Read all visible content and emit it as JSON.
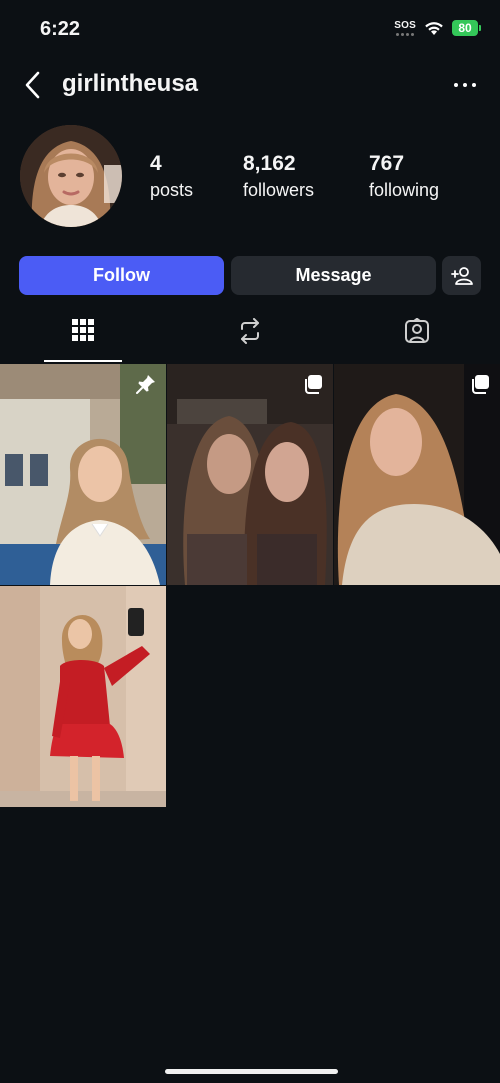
{
  "status_bar": {
    "time": "6:22",
    "sos": "SOS",
    "battery": "80",
    "battery_color": "#34c759"
  },
  "header": {
    "username": "girlintheusa",
    "back_icon": "chevron-left-icon",
    "more_icon": "more-horizontal-icon"
  },
  "profile": {
    "stats": [
      {
        "value": "4",
        "label": "posts"
      },
      {
        "value": "8,162",
        "label": "followers"
      },
      {
        "value": "767",
        "label": "following"
      }
    ]
  },
  "actions": {
    "follow_label": "Follow",
    "message_label": "Message",
    "add_user_icon": "add-user-icon",
    "follow_color": "#4b5cf5"
  },
  "tabs": [
    {
      "icon": "grid-icon",
      "active": true
    },
    {
      "icon": "reposts-icon",
      "active": false
    },
    {
      "icon": "tagged-icon",
      "active": false
    }
  ],
  "posts": [
    {
      "badge": "pin-icon"
    },
    {
      "badge": "carousel-icon"
    },
    {
      "badge": "carousel-icon"
    },
    {
      "badge": null
    }
  ]
}
